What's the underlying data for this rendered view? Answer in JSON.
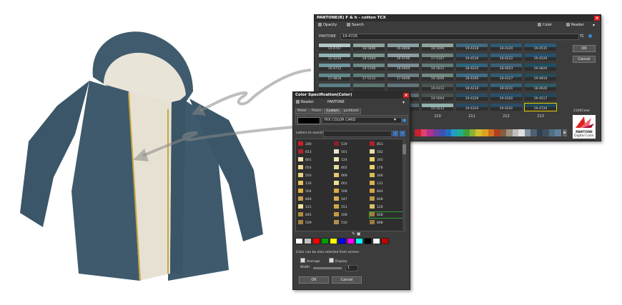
{
  "pantone_window": {
    "title": "PANTONE(R) F & h - cotton TCX",
    "toolbar": {
      "opacity": "Opacity",
      "search": "Search",
      "color": "Color",
      "reader": "Reader"
    },
    "pantone_label": "PANTONE",
    "pantone_value": "19-4726",
    "tc_label": "TC",
    "ok": "OK",
    "cancel": "Cancel",
    "colors_count": "2100Color",
    "logo_line1": "PANTONE",
    "logo_line2": "Digital Color",
    "column_numbers": [
      "210",
      "211",
      "212",
      "213"
    ],
    "rows": [
      [
        {
          "code": "14-4707",
          "color": "#b3c6c7"
        },
        {
          "code": "16-5806",
          "color": "#8fa49f"
        },
        {
          "code": "16-4408",
          "color": "#8aa0a4"
        },
        {
          "code": "16-5004",
          "color": "#8ea39c"
        },
        {
          "code": "19-4318",
          "color": "#3e6a80"
        },
        {
          "code": "18-4320",
          "color": "#2f5a74"
        },
        {
          "code": "19-4535",
          "color": "#2a5a78"
        }
      ],
      [
        {
          "code": "15-5210",
          "color": "#8db5b4"
        },
        {
          "code": "16-5304",
          "color": "#7c958f"
        },
        {
          "code": "16-4706",
          "color": "#8b9ea4"
        },
        {
          "code": "17-5107",
          "color": "#6e8580"
        },
        {
          "code": "19-4530",
          "color": "#2e5670"
        },
        {
          "code": "18-4222",
          "color": "#34607c"
        },
        {
          "code": "19-4526",
          "color": "#245270"
        }
      ],
      [
        {
          "code": "16-4712",
          "color": "#6f98a2"
        },
        {
          "code": "16-5106",
          "color": "#6e8a86"
        },
        {
          "code": "16-4404",
          "color": "#7b8f96"
        },
        {
          "code": "16-5611",
          "color": "#5f7d78"
        },
        {
          "code": "18-4225",
          "color": "#2e6680"
        },
        {
          "code": "18-4023",
          "color": "#3b6076"
        },
        {
          "code": "19-4826",
          "color": "#1f4e63"
        }
      ],
      [
        {
          "code": "17-4818",
          "color": "#5f8a8c"
        },
        {
          "code": "17-5111",
          "color": "#5d7d78"
        },
        {
          "code": "17-4408",
          "color": "#6c7f86"
        },
        {
          "code": "16-5606",
          "color": "#6f8a83"
        },
        {
          "code": "18-4340",
          "color": "#3d6e87"
        },
        {
          "code": "18-4127",
          "color": "#2f5e72"
        },
        {
          "code": "19-4916",
          "color": "#234d5a"
        }
      ],
      [
        {
          "code": "",
          "color": "#5a7f86"
        },
        {
          "code": "",
          "color": "#5a7570"
        },
        {
          "code": "",
          "color": "#62757b"
        },
        {
          "code": "19-0312",
          "color": "#4a5552"
        },
        {
          "code": "18-4234",
          "color": "#2f5a70"
        },
        {
          "code": "18-4231",
          "color": "#34637a"
        },
        {
          "code": "18-4620",
          "color": "#2c5a66"
        }
      ],
      [
        {
          "code": "",
          "color": "#4f7580"
        },
        {
          "code": "",
          "color": "#557069"
        },
        {
          "code": "",
          "color": "#5c6e74"
        },
        {
          "code": "19-5004",
          "color": "#46524f"
        },
        {
          "code": "19-4329",
          "color": "#2a4e66"
        },
        {
          "code": "19-4342",
          "color": "#27506e"
        },
        {
          "code": "19-4517",
          "color": "#22485a"
        }
      ],
      [
        {
          "code": "",
          "color": "#4a707b"
        },
        {
          "code": "",
          "color": "#4e6a63"
        },
        {
          "code": "",
          "color": "#56686e"
        },
        {
          "code": "15-5212",
          "color": "#8fb2ac"
        },
        {
          "code": "19-4324",
          "color": "#284a60"
        },
        {
          "code": "19-4241",
          "color": "#2a4c66"
        },
        {
          "code": "19-4726",
          "color": "#1f4a5a"
        }
      ]
    ]
  },
  "spec_dialog": {
    "title": "Color Specification(Color)",
    "reader": "Reader",
    "pantone": "PANTONE",
    "tabs": [
      "Meter",
      "Picker",
      "Custom",
      "pantbank"
    ],
    "card_select": "YKK COLOR CARD",
    "letters_label": "Letters to search",
    "list": [
      [
        {
          "code": "200",
          "color": "#c8202e"
        },
        {
          "code": "519",
          "color": "#8c1f2c"
        },
        {
          "code": "853",
          "color": "#b51f2b"
        }
      ],
      [
        {
          "code": "813",
          "color": "#b4242e"
        },
        {
          "code": "501",
          "color": "#e8e6c8"
        },
        {
          "code": "502",
          "color": "#e8dca6"
        }
      ],
      [
        {
          "code": "801",
          "color": "#efe6b0"
        },
        {
          "code": "124",
          "color": "#f0e8b8"
        },
        {
          "code": "345",
          "color": "#e8d070"
        }
      ],
      [
        {
          "code": "054",
          "color": "#ecd890"
        },
        {
          "code": "002",
          "color": "#e6d9a0"
        },
        {
          "code": "176",
          "color": "#ead070"
        }
      ],
      [
        {
          "code": "503",
          "color": "#e8d080"
        },
        {
          "code": "069",
          "color": "#e4c870"
        },
        {
          "code": "346",
          "color": "#d8bc50"
        }
      ],
      [
        {
          "code": "116",
          "color": "#e8c060"
        },
        {
          "code": "001",
          "color": "#eedc98"
        },
        {
          "code": "131",
          "color": "#dcb24c"
        }
      ],
      [
        {
          "code": "504",
          "color": "#e0b040"
        },
        {
          "code": "506",
          "color": "#dca848"
        },
        {
          "code": "844",
          "color": "#d2a640"
        }
      ],
      [
        {
          "code": "846",
          "color": "#c8a050"
        },
        {
          "code": "547",
          "color": "#d8b050"
        },
        {
          "code": "848",
          "color": "#c09a48"
        }
      ],
      [
        {
          "code": "121",
          "color": "#f0e2a0"
        },
        {
          "code": "551",
          "color": "#d0a848"
        },
        {
          "code": "126",
          "color": "#dcc070"
        }
      ],
      [
        {
          "code": "845",
          "color": "#b48c40"
        },
        {
          "code": "106",
          "color": "#c69a44"
        },
        {
          "code": "828",
          "color": "#a0803c"
        }
      ],
      [
        {
          "code": "509",
          "color": "#a88040"
        },
        {
          "code": "510",
          "color": "#b49050"
        },
        {
          "code": "898",
          "color": "#9a7a40"
        }
      ]
    ],
    "palette": [
      "#ffffff",
      "#c0c0c0",
      "#ff0000",
      "#00a000",
      "#ffff00",
      "#0000ff",
      "#ff00ff",
      "#00ffff",
      "#000000",
      "#ffffff",
      "#c00000"
    ],
    "info_text": "Color can be also selected from screen.",
    "average_label": "Average",
    "display_label": "Display",
    "width_label": "Width",
    "width_value": "1",
    "ok": "OK",
    "cancel": "Cancel"
  }
}
